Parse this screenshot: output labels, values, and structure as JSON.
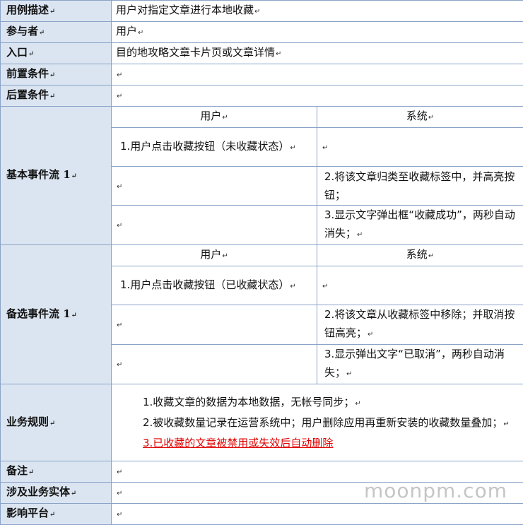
{
  "rows": {
    "desc": {
      "label": "用例描述",
      "value": "用户对指定文章进行本地收藏"
    },
    "actor": {
      "label": "参与者",
      "value": "用户"
    },
    "entry": {
      "label": "入口",
      "value": "目的地攻略文章卡片页或文章详情"
    },
    "pre": {
      "label": "前置条件",
      "value": ""
    },
    "post": {
      "label": "后置条件",
      "value": ""
    },
    "basic": {
      "label": "基本事件流 1",
      "col_user": "用户",
      "col_system": "系统",
      "user_step1": "1.用户点击收藏按钮（未收藏状态）",
      "sys_step2": "2.将该文章归类至收藏标签中，并高亮按钮；",
      "sys_step3": "3.显示文字弹出框“收藏成功”，两秒自动消失；"
    },
    "alt": {
      "label": "备选事件流 1",
      "col_user": "用户",
      "col_system": "系统",
      "user_step1": "1.用户点击收藏按钮（已收藏状态）",
      "sys_step2": "2.将该文章从收藏标签中移除；并取消按钮高亮；",
      "sys_step3": "3.显示弹出文字“已取消”，两秒自动消失；"
    },
    "rules": {
      "label": "业务规则",
      "rule1": "1.收藏文章的数据为本地数据，无帐号同步；",
      "rule2": "2.被收藏数量记录在运营系统中；用户删除应用再重新安装的收藏数量叠加；",
      "rule3": "3.已收藏的文章被禁用或失效后自动删除"
    },
    "note": {
      "label": "备注",
      "value": ""
    },
    "entity": {
      "label": "涉及业务实体",
      "value": ""
    },
    "platform": {
      "label": "影响平台",
      "value": ""
    }
  },
  "paragraph_mark": "↵",
  "watermark": "moonpm.com"
}
